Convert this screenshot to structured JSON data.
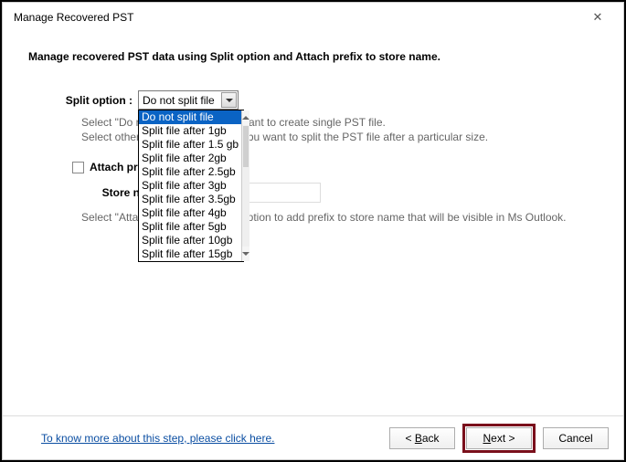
{
  "window": {
    "title": "Manage Recovered PST",
    "close": "✕"
  },
  "heading": "Manage recovered PST data using Split option and Attach prefix to store name.",
  "split": {
    "label": "Split option :",
    "selected": "Do not split file",
    "options": [
      "Do not split file",
      "Split file after 1gb",
      "Split file after 1.5 gb",
      "Split file after 2gb",
      "Split file after 2.5gb",
      "Split file after 3gb",
      "Split file after 3.5gb",
      "Split file after 4gb",
      "Split file after 5gb",
      "Split file after 10gb",
      "Split file after 15gb"
    ]
  },
  "hint1_a": "Select \"Do n",
  "hint1_b": "ant to create single PST file.",
  "hint1_c": "Select other P",
  "hint1_d": "bu want to split the PST file after a particular size.",
  "attach": {
    "label_part": "Attach prefix t",
    "store_label": "Store name",
    "hint_a": "Select \"Attach",
    "hint_b": "ption to add prefix to store name that will be visible in Ms Outlook."
  },
  "footer": {
    "help": "To know more about this step, please click here.",
    "back_lt": "<",
    "back_u": "B",
    "back_rest": "ack",
    "next_u": "N",
    "next_rest": "ext >",
    "cancel": "Cancel"
  }
}
